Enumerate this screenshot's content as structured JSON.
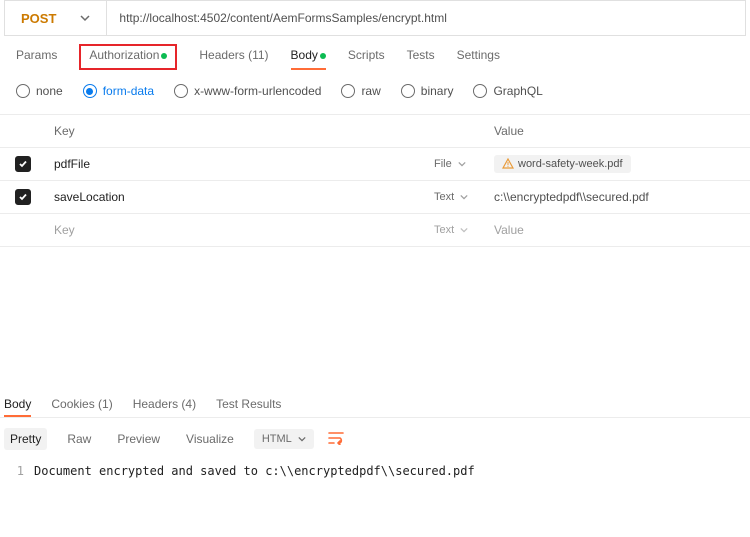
{
  "method": "POST",
  "url": "http://localhost:4502/content/AemFormsSamples/encrypt.html",
  "request_tabs": {
    "params": "Params",
    "authorization": "Authorization",
    "headers": {
      "label": "Headers",
      "count_suffix": " (11)"
    },
    "body": "Body",
    "scripts": "Scripts",
    "tests": "Tests",
    "settings": "Settings"
  },
  "body_types": {
    "none": "none",
    "form_data": "form-data",
    "urlencoded": "x-www-form-urlencoded",
    "raw": "raw",
    "binary": "binary",
    "graphql": "GraphQL"
  },
  "form_table": {
    "header_key": "Key",
    "header_value": "Value",
    "placeholder_key": "Key",
    "placeholder_value": "Value",
    "rows": [
      {
        "key": "pdfFile",
        "type": "File",
        "value": "word-safety-week.pdf"
      },
      {
        "key": "saveLocation",
        "type": "Text",
        "value": "c:\\\\encryptedpdf\\\\secured.pdf"
      }
    ],
    "placeholder_type": "Text"
  },
  "response_tabs": {
    "body": "Body",
    "cookies": {
      "label": "Cookies",
      "count_suffix": " (1)"
    },
    "headers": {
      "label": "Headers",
      "count_suffix": " (4)"
    },
    "test_results": "Test Results"
  },
  "response_toolbar": {
    "pretty": "Pretty",
    "raw": "Raw",
    "preview": "Preview",
    "visualize": "Visualize",
    "lang": "HTML"
  },
  "response_body": {
    "line_number": "1",
    "text": "Document encrypted and saved to c:\\\\encryptedpdf\\\\secured.pdf"
  }
}
